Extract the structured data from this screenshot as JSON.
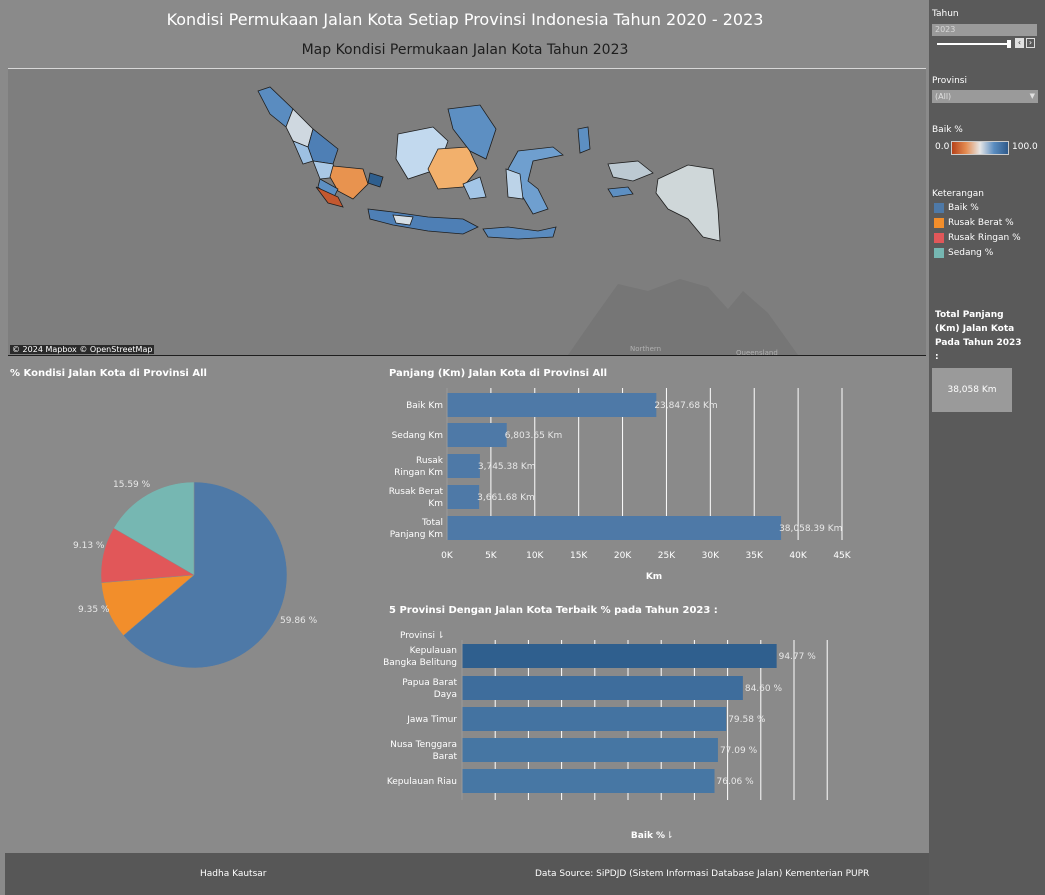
{
  "header": {
    "title": "Kondisi Permukaan Jalan Kota Setiap Provinsi Indonesia Tahun 2020 - 2023",
    "map_title": "Map Kondisi Permukaan Jalan Kota Tahun 2023"
  },
  "map": {
    "attribution": "© 2024 Mapbox © OpenStreetMap",
    "place_labels": [
      "Northern",
      "Queensland"
    ]
  },
  "pie": {
    "title": "% Kondisi Jalan Kota di Provinsi All",
    "labels": [
      "59.86 %",
      "9.35 %",
      "9.13 %",
      "15.59 %"
    ]
  },
  "bar_panjang": {
    "title": "Panjang (Km) Jalan Kota di Provinsi All",
    "xlabel": "Km"
  },
  "bar_top5": {
    "title": "5 Provinsi Dengan Jalan Kota Terbaik % pada Tahun 2023 :",
    "header_label": "Provinsi",
    "xlabel": "Baik %"
  },
  "sidebar": {
    "tahun_label": "Tahun",
    "tahun_value": "2023",
    "provinsi_label": "Provinsi",
    "provinsi_value": "(All)",
    "baik_label": "Baik %",
    "scale_min": "0.0",
    "scale_max": "100.0",
    "legend_title": "Keterangan",
    "legend": [
      {
        "label": "Baik %",
        "color": "#4e79a7"
      },
      {
        "label": "Rusak Berat %",
        "color": "#f28e2b"
      },
      {
        "label": "Rusak Ringan %",
        "color": "#e15759"
      },
      {
        "label": "Sedang %",
        "color": "#76b7b2"
      }
    ],
    "total_title": "Total Panjang (Km) Jalan Kota Pada Tahun 2023 :",
    "total_value": "38,058 Km"
  },
  "footer": {
    "author": "Hadha Kautsar",
    "source": "Data Source: SiPDJD (Sistem Informasi Database Jalan) Kementerian PUPR"
  },
  "chart_data": [
    {
      "type": "pie",
      "title": "% Kondisi Jalan Kota di Provinsi All",
      "categories": [
        "Baik %",
        "Rusak Berat %",
        "Rusak Ringan %",
        "Sedang %"
      ],
      "values": [
        59.86,
        9.35,
        9.13,
        15.59
      ],
      "value_labels": [
        "59.86 %",
        "9.35 %",
        "9.13 %",
        "15.59 %"
      ],
      "colors": [
        "#4e79a7",
        "#f28e2b",
        "#e15759",
        "#76b7b2"
      ]
    },
    {
      "type": "bar",
      "orientation": "horizontal",
      "title": "Panjang (Km) Jalan Kota di Provinsi All",
      "categories": [
        "Baik Km",
        "Sedang Km",
        "Rusak Ringan Km",
        "Rusak Berat Km",
        "Total Panjang Km"
      ],
      "category_lines": [
        [
          "Baik Km"
        ],
        [
          "Sedang Km"
        ],
        [
          "Rusak",
          "Ringan Km"
        ],
        [
          "Rusak Berat",
          "Km"
        ],
        [
          "Total",
          "Panjang Km"
        ]
      ],
      "values": [
        23847.68,
        6803.65,
        3745.38,
        3661.68,
        38058.39
      ],
      "value_labels": [
        "23,847.68 Km",
        "6,803.65 Km",
        "3,745.38 Km",
        "3,661.68 Km",
        "38,058.39 Km"
      ],
      "xlabel": "Km",
      "xlim": [
        0,
        45000
      ],
      "xticks": [
        0,
        5000,
        10000,
        15000,
        20000,
        25000,
        30000,
        35000,
        40000,
        45000
      ],
      "xtick_labels": [
        "0K",
        "5K",
        "10K",
        "15K",
        "20K",
        "25K",
        "30K",
        "35K",
        "40K",
        "45K"
      ],
      "bar_color": "#4e79a7"
    },
    {
      "type": "bar",
      "orientation": "horizontal",
      "title": "5 Provinsi Dengan Jalan Kota Terbaik % pada Tahun 2023 :",
      "categories": [
        "Kepulauan Bangka Belitung",
        "Papua Barat Daya",
        "Jawa Timur",
        "Nusa Tenggara Barat",
        "Kepulauan Riau"
      ],
      "category_lines": [
        [
          "Kepulauan",
          "Bangka Belitung"
        ],
        [
          "Papua Barat",
          "Daya"
        ],
        [
          "Jawa Timur"
        ],
        [
          "Nusa Tenggara",
          "Barat"
        ],
        [
          "Kepulauan Riau"
        ]
      ],
      "values": [
        94.77,
        84.6,
        79.58,
        77.09,
        76.06
      ],
      "value_labels": [
        "94.77 %",
        "84.60 %",
        "79.58 %",
        "77.09 %",
        "76.06 %"
      ],
      "xlabel": "Baik %",
      "xlim": [
        0,
        110
      ],
      "bar_colors": [
        "#2f5f8e",
        "#3e6d9c",
        "#4473a1",
        "#4676a3",
        "#4777a4"
      ]
    }
  ]
}
